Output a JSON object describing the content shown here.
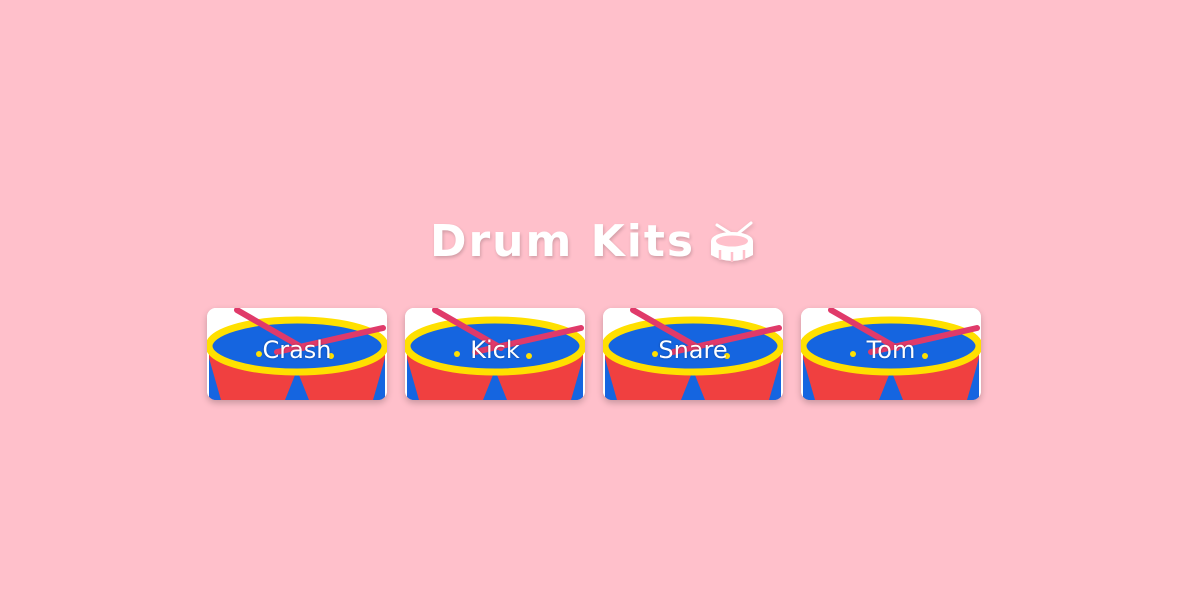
{
  "header": {
    "title": "Drum Kits",
    "icon": "drum-icon"
  },
  "pads": [
    {
      "label": "Crash"
    },
    {
      "label": "Kick"
    },
    {
      "label": "Snare"
    },
    {
      "label": "Tom"
    }
  ],
  "colors": {
    "background": "#ffc0cb",
    "drum_head": "#1565e0",
    "drum_rim": "#ffe000",
    "drum_body": "#f04040",
    "stick": "#e03a6a",
    "text": "#ffffff"
  }
}
